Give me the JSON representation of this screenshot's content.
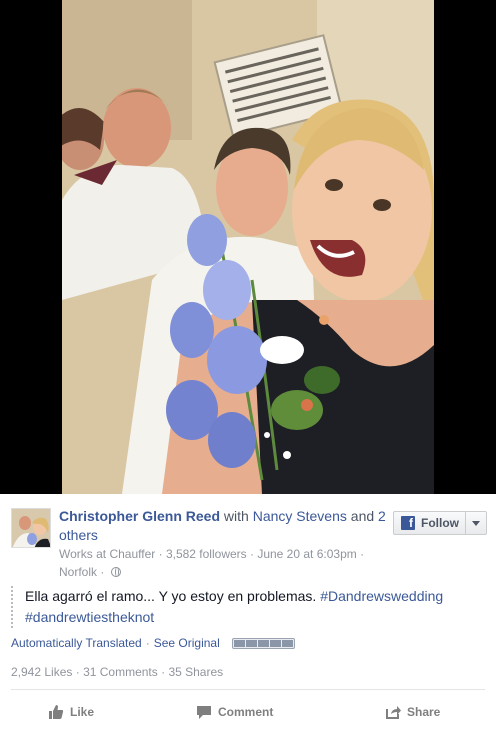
{
  "post": {
    "author": "Christopher Glenn Reed",
    "with_text": "with",
    "tagged_name": "Nancy Stevens",
    "and_text": "and",
    "others_text": "2 others",
    "work": "Works at Chauffer",
    "followers": "3,582 followers",
    "date": "June 20 at 6:03pm",
    "location": "Norfolk",
    "message_text": "Ella agarró el ramo... Y yo estoy en problemas.",
    "hashtag_1": "#Dandrewswedding",
    "hashtag_2": "#dandrewtiestheknot"
  },
  "follow": {
    "label": "Follow",
    "fb_letter": "f"
  },
  "translation": {
    "auto_label": "Automatically Translated",
    "see_original": "See Original",
    "rating_segments": 5
  },
  "stats": {
    "likes": "2,942 Likes",
    "comments": "31 Comments",
    "shares": "35 Shares"
  },
  "actions": {
    "like": "Like",
    "comment": "Comment",
    "share": "Share"
  },
  "colors": {
    "link": "#3b5998",
    "meta": "#90949c",
    "action": "#7f7f7f"
  },
  "icons": [
    "globe-icon",
    "facebook-f-icon",
    "chevron-down-icon",
    "thumbs-up-icon",
    "comment-icon",
    "share-icon"
  ]
}
